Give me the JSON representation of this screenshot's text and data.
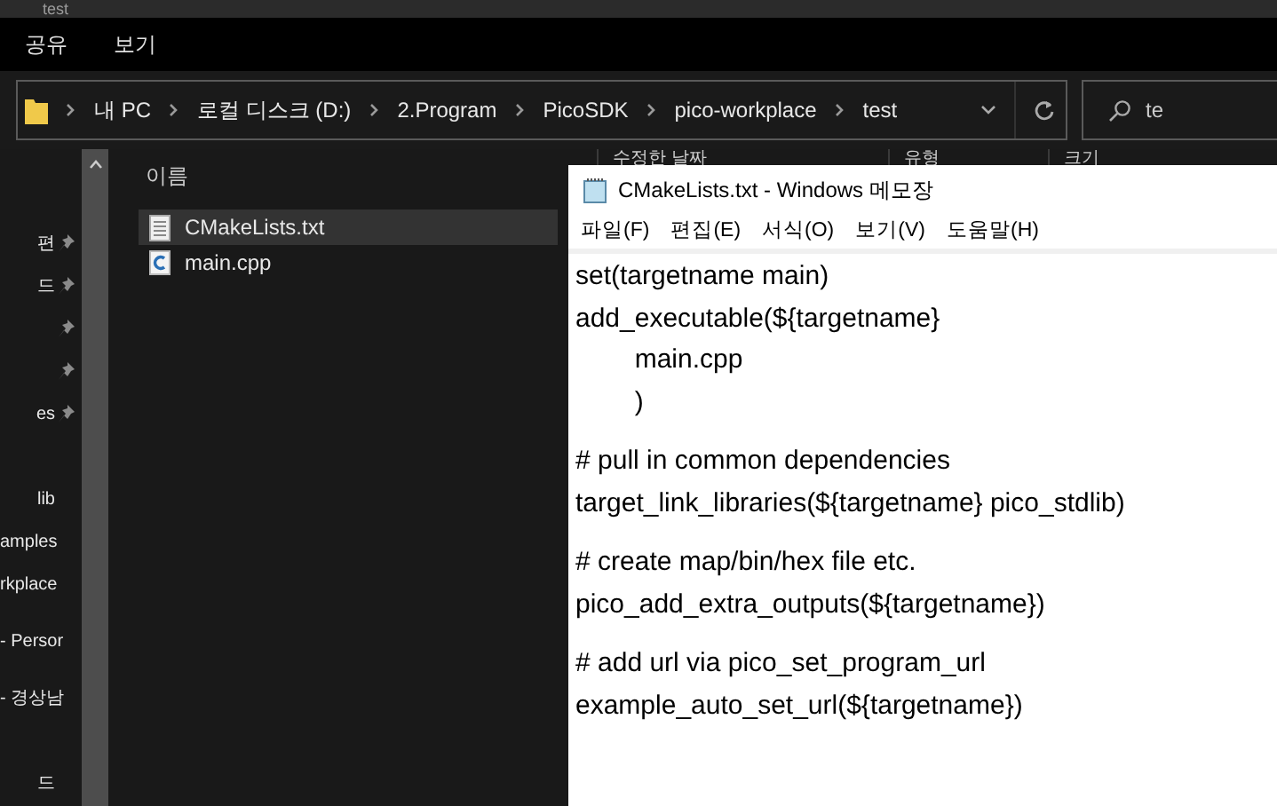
{
  "window": {
    "title": "test"
  },
  "ribbon_tabs": [
    {
      "label": "공유",
      "selected": false
    },
    {
      "label": "보기",
      "selected": false
    }
  ],
  "address": {
    "crumbs": [
      "내 PC",
      "로컬 디스크 (D:)",
      "2.Program",
      "PicoSDK",
      "pico-workplace",
      "test"
    ],
    "search_value": "te"
  },
  "sidebar": {
    "items": [
      {
        "label": "편",
        "pinned": true
      },
      {
        "label": "드",
        "pinned": true
      },
      {
        "pinned": true
      },
      {
        "pinned": true
      },
      {
        "label": "es",
        "pinned": true
      },
      {
        "pinned": false
      },
      {
        "label": "lib",
        "pinned": false
      },
      {
        "label": "amples",
        "pinned": false
      },
      {
        "label": "rkplace",
        "pinned": false
      },
      {
        "label": "- Persor",
        "pinned": false
      },
      {
        "label": "- 경상남",
        "pinned": false
      },
      {
        "pinned": false
      },
      {
        "label": "드",
        "pinned": false
      }
    ]
  },
  "columns": [
    "이름",
    "수정한 날짜",
    "유형",
    "크기"
  ],
  "files": [
    {
      "name": "CMakeLists.txt",
      "kind": "text",
      "selected": true
    },
    {
      "name": "main.cpp",
      "kind": "cpp",
      "selected": false
    }
  ],
  "notepad": {
    "title": "CMakeLists.txt - Windows 메모장",
    "menu": [
      "파일(F)",
      "편집(E)",
      "서식(O)",
      "보기(V)",
      "도움말(H)"
    ],
    "paragraphs": [
      [
        "set(targetname main)",
        "add_executable(${targetname}",
        "        main.cpp",
        "        )"
      ],
      [
        "# pull in common dependencies",
        "target_link_libraries(${targetname} pico_stdlib)"
      ],
      [
        "# create map/bin/hex file etc.",
        "pico_add_extra_outputs(${targetname})"
      ],
      [
        "# add url via pico_set_program_url",
        "example_auto_set_url(${targetname})"
      ]
    ]
  }
}
